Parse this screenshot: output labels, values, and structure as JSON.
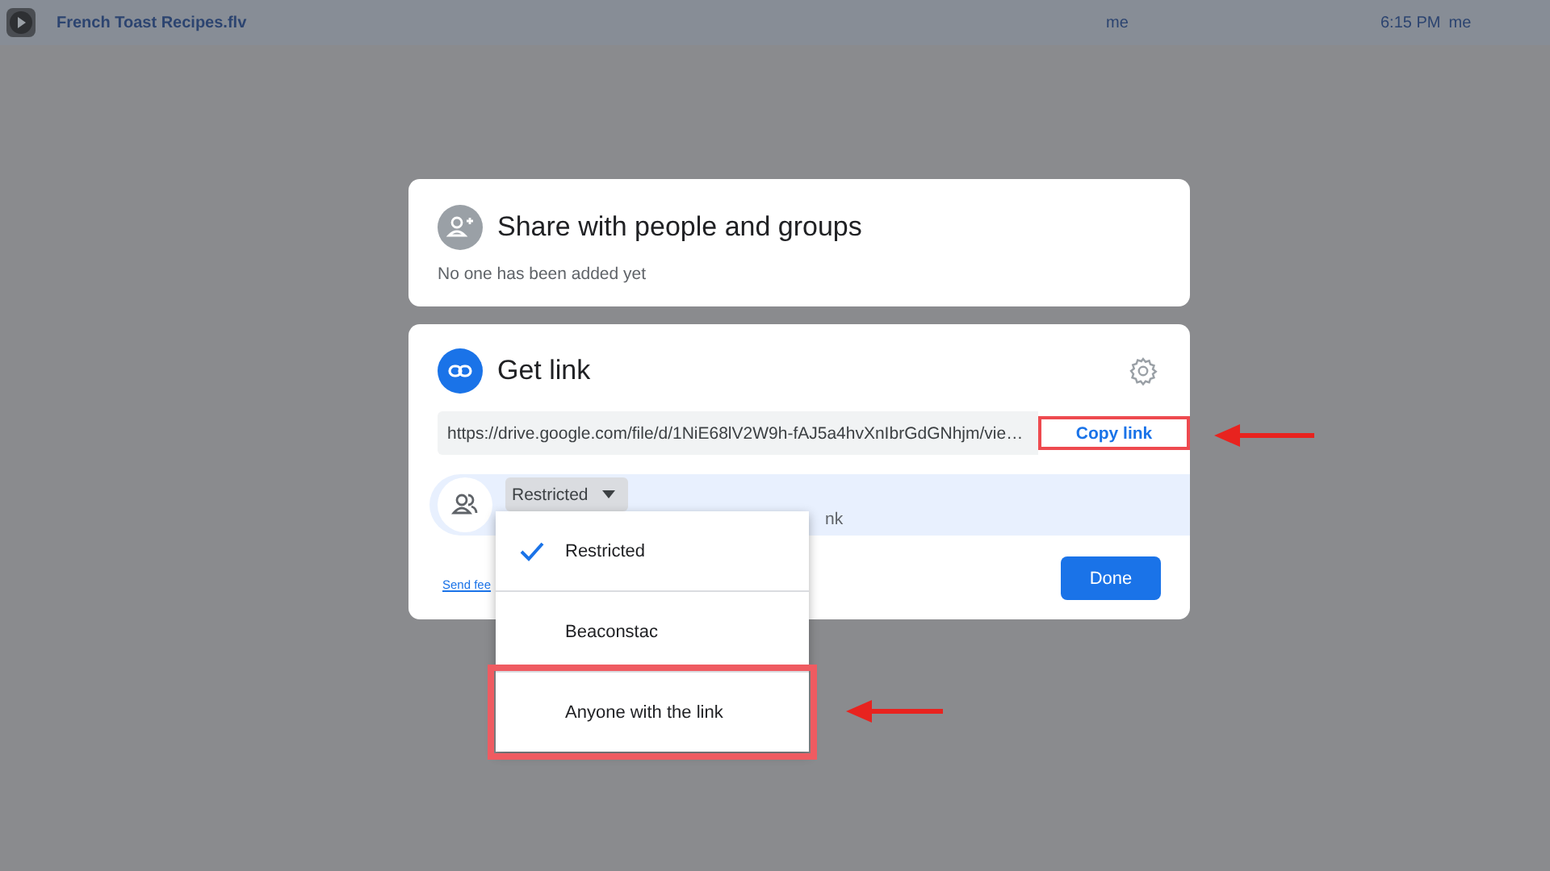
{
  "file_row": {
    "name": "French Toast Recipes.flv",
    "owner": "me",
    "modified": "6:15 PM",
    "modified_by": "me"
  },
  "share_card": {
    "title": "Share with people and groups",
    "status": "No one has been added yet"
  },
  "link_card": {
    "title": "Get link",
    "url": "https://drive.google.com/file/d/1NiE68lV2W9h-fAJ5a4hvXnIbrGdGNhjm/vie…",
    "copy_label": "Copy link",
    "copy_highlighted": true,
    "access": "Restricted",
    "access_description": "nk",
    "feedback": "Send fee",
    "done": "Done"
  },
  "access_menu": {
    "items": [
      {
        "label": "Restricted",
        "selected": true,
        "highlighted": false
      },
      {
        "label": "Beaconstac",
        "selected": false,
        "highlighted": false
      },
      {
        "label": "Anyone with the link",
        "selected": false,
        "highlighted": true
      }
    ]
  }
}
